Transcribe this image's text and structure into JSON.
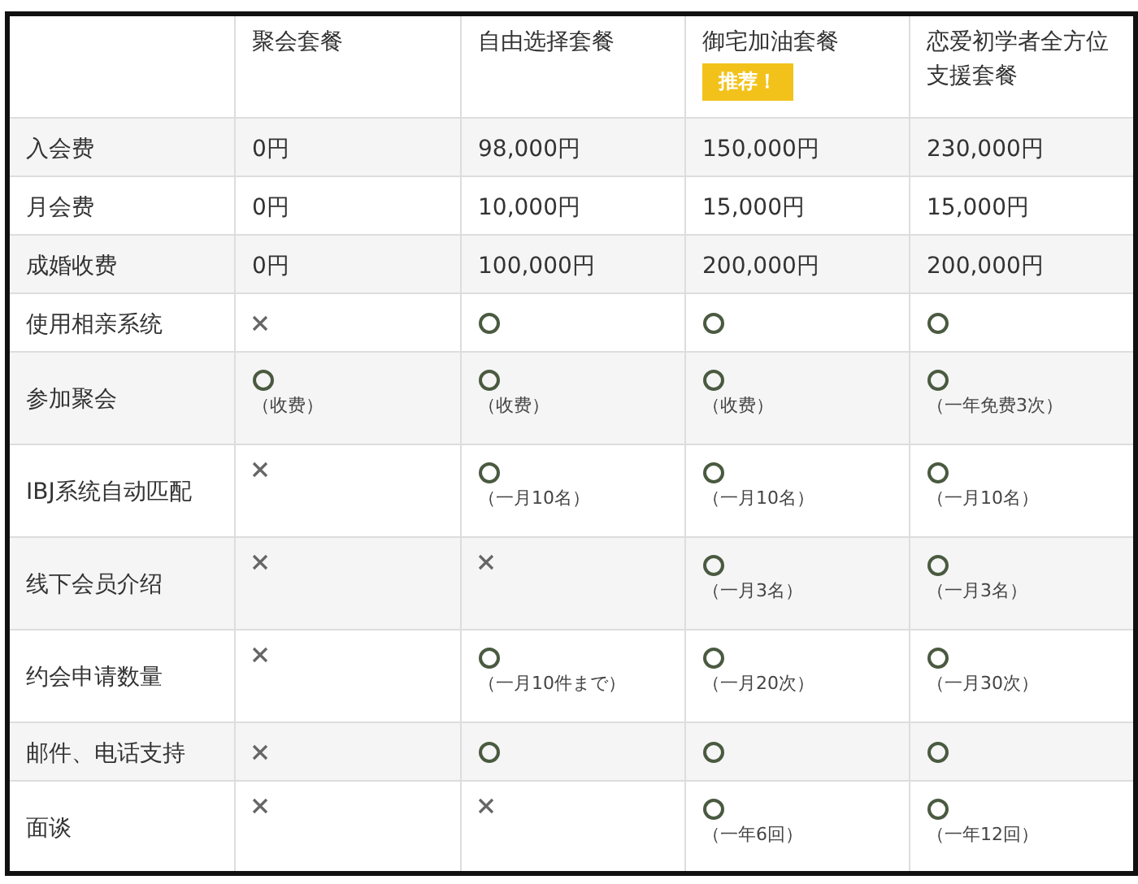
{
  "table": {
    "columns": [
      {
        "label": "聚会套餐"
      },
      {
        "label": "自由选择套餐"
      },
      {
        "label": "御宅加油套餐",
        "badge": "推荐！"
      },
      {
        "label": "恋爱初学者全方位支援套餐"
      }
    ],
    "rows": [
      {
        "label": "入会费",
        "cells": [
          {
            "kind": "text",
            "text": "0円"
          },
          {
            "kind": "text",
            "text": "98,000円"
          },
          {
            "kind": "text",
            "text": "150,000円"
          },
          {
            "kind": "text",
            "text": "230,000円"
          }
        ]
      },
      {
        "label": "月会费",
        "cells": [
          {
            "kind": "text",
            "text": "0円"
          },
          {
            "kind": "text",
            "text": "10,000円"
          },
          {
            "kind": "text",
            "text": "15,000円"
          },
          {
            "kind": "text",
            "text": "15,000円"
          }
        ]
      },
      {
        "label": "成婚收费",
        "cells": [
          {
            "kind": "text",
            "text": "0円"
          },
          {
            "kind": "text",
            "text": "100,000円"
          },
          {
            "kind": "text",
            "text": "200,000円"
          },
          {
            "kind": "text",
            "text": "200,000円"
          }
        ]
      },
      {
        "label": "使用相亲系统",
        "cells": [
          {
            "kind": "no"
          },
          {
            "kind": "yes"
          },
          {
            "kind": "yes"
          },
          {
            "kind": "yes"
          }
        ]
      },
      {
        "label": "参加聚会",
        "cells": [
          {
            "kind": "yes",
            "note": "（收费）"
          },
          {
            "kind": "yes",
            "note": "（收费）"
          },
          {
            "kind": "yes",
            "note": "（收费）"
          },
          {
            "kind": "yes",
            "note": "（一年免费3次）"
          }
        ]
      },
      {
        "label": "IBJ系统自动匹配",
        "cells": [
          {
            "kind": "no"
          },
          {
            "kind": "yes",
            "note": "（一月10名）"
          },
          {
            "kind": "yes",
            "note": "（一月10名）"
          },
          {
            "kind": "yes",
            "note": "（一月10名）"
          }
        ]
      },
      {
        "label": "线下会员介绍",
        "cells": [
          {
            "kind": "no"
          },
          {
            "kind": "no"
          },
          {
            "kind": "yes",
            "note": "（一月3名）"
          },
          {
            "kind": "yes",
            "note": "（一月3名）"
          }
        ]
      },
      {
        "label": "约会申请数量",
        "cells": [
          {
            "kind": "no"
          },
          {
            "kind": "yes",
            "note": "（一月10件まで）"
          },
          {
            "kind": "yes",
            "note": "（一月20次）"
          },
          {
            "kind": "yes",
            "note": "（一月30次）"
          }
        ]
      },
      {
        "label": "邮件、电话支持",
        "cells": [
          {
            "kind": "no"
          },
          {
            "kind": "yes"
          },
          {
            "kind": "yes"
          },
          {
            "kind": "yes"
          }
        ]
      },
      {
        "label": "面谈",
        "cells": [
          {
            "kind": "no"
          },
          {
            "kind": "no"
          },
          {
            "kind": "yes",
            "note": "（一年6回）"
          },
          {
            "kind": "yes",
            "note": "（一年12回）"
          }
        ]
      }
    ]
  }
}
